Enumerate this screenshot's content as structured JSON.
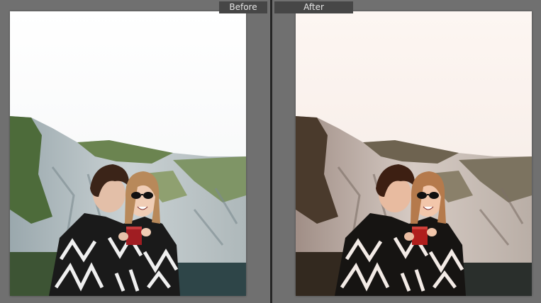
{
  "panes": {
    "before": {
      "label": "Before"
    },
    "after": {
      "label": "After"
    }
  },
  "colors": {
    "background": "#707070",
    "divider": "#262626",
    "label_bg": "#464646",
    "label_text": "#e6e6e6"
  }
}
